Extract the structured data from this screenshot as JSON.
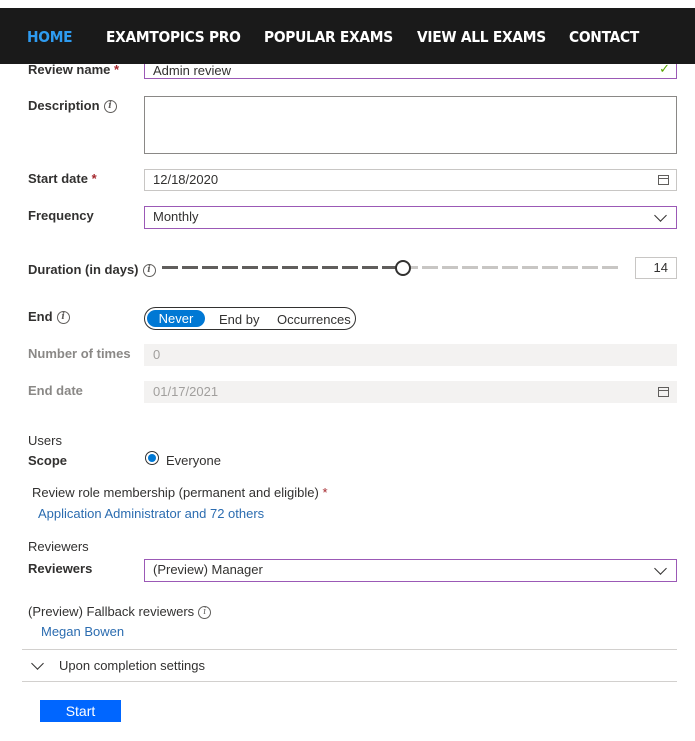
{
  "nav": {
    "items": [
      "HOME",
      "EXAMTOPICS PRO",
      "POPULAR EXAMS",
      "VIEW ALL EXAMS",
      "CONTACT"
    ]
  },
  "form": {
    "review_name": {
      "label": "Review name",
      "required": "*",
      "value": "Admin review"
    },
    "description": {
      "label": "Description",
      "value": ""
    },
    "start_date": {
      "label": "Start date",
      "required": "*",
      "value": "12/18/2020"
    },
    "frequency": {
      "label": "Frequency",
      "value": "Monthly"
    },
    "duration": {
      "label": "Duration (in days)",
      "value": "14",
      "slider_fraction": 0.52
    },
    "end": {
      "label": "End",
      "options": [
        "Never",
        "End by",
        "Occurrences"
      ],
      "selected": "Never"
    },
    "number_of_times": {
      "label": "Number of times",
      "value": "0"
    },
    "end_date": {
      "label": "End date",
      "value": "01/17/2021"
    },
    "users": {
      "section_title": "Users",
      "scope_label": "Scope",
      "scope_value": "Everyone",
      "role_membership_label": "Review role membership (permanent and eligible)",
      "role_membership_required": "*",
      "role_membership_link": "Application Administrator and 72 others"
    },
    "reviewers": {
      "section_title": "Reviewers",
      "label": "Reviewers",
      "value": "(Preview) Manager",
      "fallback_label": "(Preview) Fallback reviewers",
      "fallback_link": "Megan Bowen"
    },
    "completion": {
      "label": "Upon completion settings"
    },
    "start_button": "Start"
  },
  "colors": {
    "nav_bg": "#1a1a1a",
    "nav_active": "#2e9bf0",
    "accent": "#0078d4",
    "focus_border": "#9b59b6",
    "button": "#0066ff",
    "link": "#2b6cb0"
  }
}
